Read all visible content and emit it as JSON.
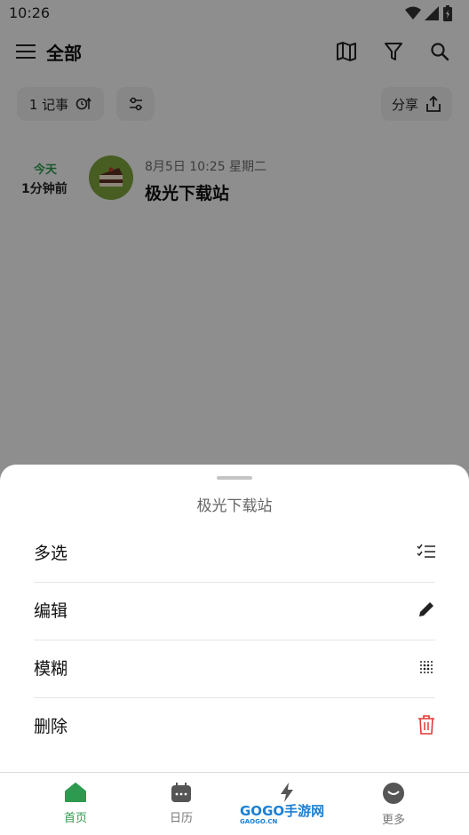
{
  "status_bar": {
    "time": "10:26"
  },
  "header": {
    "title": "全部"
  },
  "chips": {
    "notes_count": "1 记事",
    "share": "分享"
  },
  "note": {
    "day_label": "今天",
    "relative_time": "1分钟前",
    "datetime": "8月5日 10:25 星期二",
    "title": "极光下载站"
  },
  "sheet": {
    "title": "极光下载站",
    "items": [
      {
        "label": "多选",
        "icon": "checklist-icon"
      },
      {
        "label": "编辑",
        "icon": "pencil-icon"
      },
      {
        "label": "模糊",
        "icon": "blur-dots-icon"
      },
      {
        "label": "删除",
        "icon": "trash-icon",
        "color": "#e53935"
      }
    ]
  },
  "nav": {
    "items": [
      {
        "label": "首页",
        "icon": "home-icon",
        "active": true
      },
      {
        "label": "日历",
        "icon": "calendar-icon"
      },
      {
        "label": "",
        "icon": "bolt-icon"
      },
      {
        "label": "更多",
        "icon": "smile-icon"
      }
    ],
    "watermark": "GOGO手游网",
    "watermark_small": "GAOGO.CN"
  },
  "colors": {
    "accent": "#2e9a4f",
    "danger": "#e53935"
  }
}
